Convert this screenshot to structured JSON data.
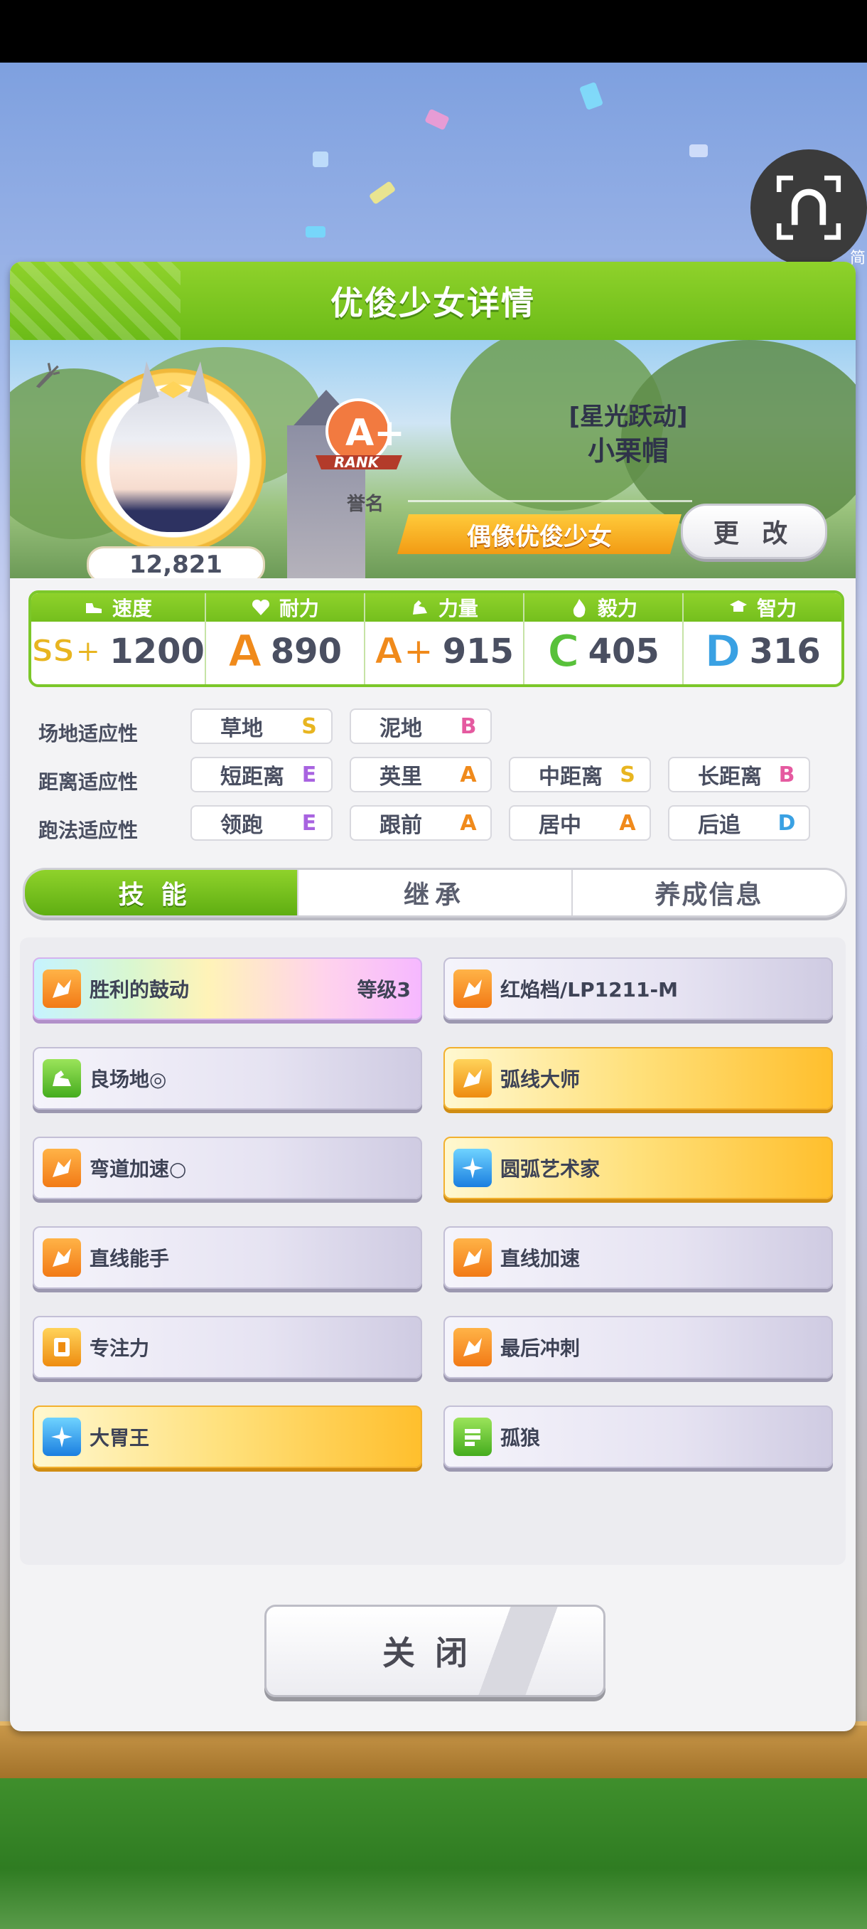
{
  "header": {
    "title": "优俊少女详情"
  },
  "floating_button": {
    "label": "简"
  },
  "profile": {
    "score": "12,821",
    "rank_label": "誉名",
    "rank_grade": "A+",
    "rank_word": "RANK",
    "epithet": "[星光跃动]",
    "name": "小栗帽",
    "nickname": "偶像优俊少女",
    "change_label": "更 改"
  },
  "stats": [
    {
      "label": "速度",
      "grade": "SS+",
      "value": "1200",
      "icon": "shoe-icon"
    },
    {
      "label": "耐力",
      "grade": "A",
      "value": "890",
      "icon": "heart-icon"
    },
    {
      "label": "力量",
      "grade": "A+",
      "value": "915",
      "icon": "arm-icon"
    },
    {
      "label": "毅力",
      "grade": "C",
      "value": "405",
      "icon": "flame-icon"
    },
    {
      "label": "智力",
      "grade": "D",
      "value": "316",
      "icon": "graduation-cap-icon"
    }
  ],
  "aptitudes": {
    "track_label": "场地适应性",
    "track": [
      {
        "name": "草地",
        "grade": "S"
      },
      {
        "name": "泥地",
        "grade": "B"
      }
    ],
    "distance_label": "距离适应性",
    "distance": [
      {
        "name": "短距离",
        "grade": "E"
      },
      {
        "name": "英里",
        "grade": "A"
      },
      {
        "name": "中距离",
        "grade": "S"
      },
      {
        "name": "长距离",
        "grade": "B"
      }
    ],
    "style_label": "跑法适应性",
    "style": [
      {
        "name": "领跑",
        "grade": "E"
      },
      {
        "name": "跟前",
        "grade": "A"
      },
      {
        "name": "居中",
        "grade": "A"
      },
      {
        "name": "后追",
        "grade": "D"
      }
    ]
  },
  "tabs": [
    {
      "label": "技能"
    },
    {
      "label": "继承"
    },
    {
      "label": "养成信息"
    }
  ],
  "skills": [
    {
      "name": "胜利的鼓动",
      "level": "等级3",
      "style": "rainbow",
      "icon": "orange"
    },
    {
      "name": "红焰档/LP1211-M",
      "level": "",
      "style": "normal",
      "icon": "orange"
    },
    {
      "name": "良场地◎",
      "level": "",
      "style": "normal",
      "icon": "green"
    },
    {
      "name": "弧线大师",
      "level": "",
      "style": "gold",
      "icon": "amber"
    },
    {
      "name": "弯道加速○",
      "level": "",
      "style": "normal",
      "icon": "orange"
    },
    {
      "name": "圆弧艺术家",
      "level": "",
      "style": "gold",
      "icon": "blue"
    },
    {
      "name": "直线能手",
      "level": "",
      "style": "normal",
      "icon": "orange"
    },
    {
      "name": "直线加速",
      "level": "",
      "style": "normal",
      "icon": "orange"
    },
    {
      "name": "专注力",
      "level": "",
      "style": "normal",
      "icon": "amber"
    },
    {
      "name": "最后冲刺",
      "level": "",
      "style": "normal",
      "icon": "orange"
    },
    {
      "name": "大胃王",
      "level": "",
      "style": "gold",
      "icon": "blue"
    },
    {
      "name": "孤狼",
      "level": "",
      "style": "normal",
      "icon": "green"
    }
  ],
  "footer": {
    "close_label": "关闭"
  }
}
